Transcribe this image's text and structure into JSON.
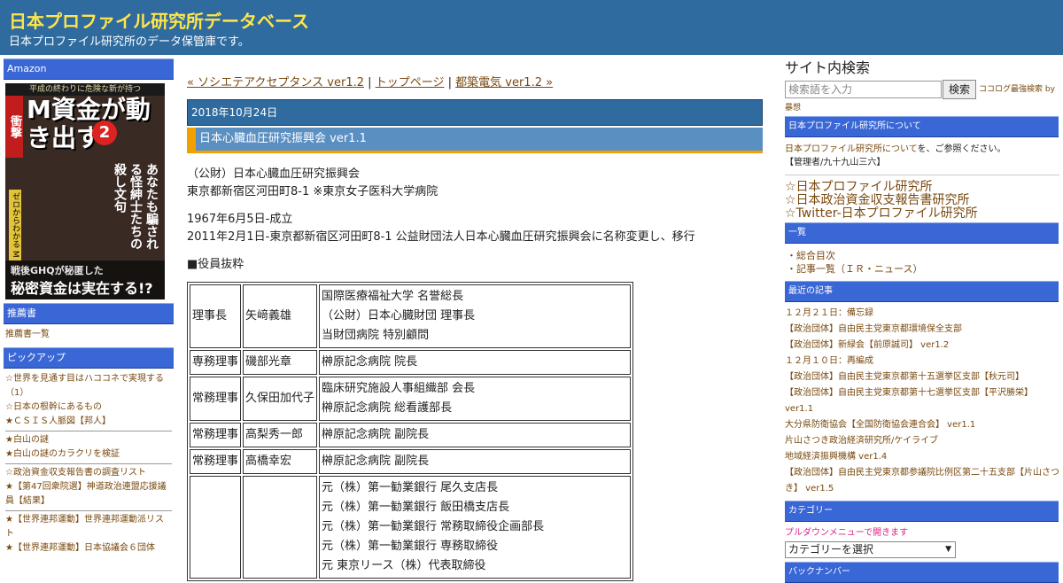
{
  "header": {
    "title": "日本プロファイル研究所データベース",
    "description": "日本プロファイル研究所のデータ保管庫です。"
  },
  "left": {
    "amazon_title": "Amazon",
    "ad": {
      "top_text": "平成の終わりに危険な新が持つ",
      "red_label": "衝撃",
      "title": "M資金が動き出す",
      "number": "2",
      "side_text": "あなたも騙される怪紳士たちの殺し文句",
      "yellow_text": "ゼロからわかる M資金読本",
      "band_line1": "戦後GHQが秘匿した",
      "band_line2": "秘密資金は実在する!?"
    },
    "recommend_title": "推薦書",
    "recommend_link": "推薦書一覧",
    "pickup_title": "ピックアップ",
    "pickup_groups": [
      [
        "☆世界を見通す目はハココネで実現する（1）",
        "☆日本の根幹にあるもの",
        "★ＣＳＩＳ人脈図【邦人】"
      ],
      [
        "★白山の謎",
        "★白山の謎のカラクリを検証"
      ],
      [
        "☆政治資金収支報告書の調査リスト",
        "★【第47回衆院選】神道政治連盟応援議員【結果】"
      ],
      [
        "★【世界連邦運動】世界連邦運動派リスト",
        "★【世界連邦運動】日本協議会６団体"
      ]
    ]
  },
  "main": {
    "nav": {
      "prev": "« ソシエテアクセプタンス ver1.2",
      "sep": "|",
      "top": "トップページ",
      "next": "都築電気 ver1.2 »"
    },
    "date": "2018年10月24日",
    "post_title": "日本心臓血圧研究振興会 ver1.1",
    "lines": [
      "（公財）日本心臓血圧研究振興会",
      "東京都新宿区河田町8-1 ※東京女子医科大学病院",
      "1967年6月5日-成立",
      "2011年2月1日-東京都新宿区河田町8-1 公益財団法人日本心臓血圧研究振興会に名称変更し、移行",
      "■役員抜粋"
    ],
    "officers": [
      {
        "role": "理事長",
        "name": "矢﨑義雄",
        "titles": [
          "国際医療福祉大学 名誉総長",
          "（公財）日本心臓財団 理事長",
          "当財団病院 特別顧問"
        ]
      },
      {
        "role": "専務理事",
        "name": "磯部光章",
        "titles": [
          "榊原記念病院 院長"
        ]
      },
      {
        "role": "常務理事",
        "name": "久保田加代子",
        "titles": [
          "臨床研究施設人事組織部 会長",
          "榊原記念病院 総看護部長"
        ]
      },
      {
        "role": "常務理事",
        "name": "高梨秀一郎",
        "titles": [
          "榊原記念病院 副院長"
        ]
      },
      {
        "role": "常務理事",
        "name": "高橋幸宏",
        "titles": [
          "榊原記念病院 副院長"
        ]
      },
      {
        "role": "",
        "name": "",
        "titles": [
          "元（株）第一勧業銀行 尾久支店長",
          "元（株）第一勧業銀行 飯田橋支店長",
          "元（株）第一勧業銀行 常務取締役企画部長",
          "元（株）第一勧業銀行 専務取締役",
          "元 東京リース（株）代表取締役"
        ]
      }
    ]
  },
  "right": {
    "search_title": "サイト内検索",
    "search_placeholder": "検索語を入力",
    "search_button": "検索",
    "search_credit": "ココログ最強検索 by",
    "search_credit2": "暴想",
    "about_title": "日本プロファイル研究所について",
    "about_link": "日本プロファイル研究所について",
    "about_suffix": "を、ご参照ください。",
    "admin": "【管理者/九十九山三六】",
    "links": [
      "☆日本プロファイル研究所",
      "☆日本政治資金収支報告書研究所",
      "☆Twitter-日本プロファイル研究所"
    ],
    "list_title": "一覧",
    "list_items": [
      "・総合目次",
      "・記事一覧（ＩＲ・ニュース）"
    ],
    "recent_title": "最近の記事",
    "recent_items": [
      "１２月２１日：備忘録",
      "【政治団体】自由民主党東京都環境保全支部",
      "【政治団体】新緑会【前原誠司】 ver1.2",
      "１２月１０日：再編成",
      "【政治団体】自由民主党東京都第十五選挙区支部【秋元司】",
      "【政治団体】自由民主党東京都第十七選挙区支部【平沢勝栄】 ver1.1",
      "大分県防衛協会【全国防衛協会連合会】 ver1.1",
      "片山さつき政治経済研究所/ケイライブ",
      "地域経済振興機構 ver1.4",
      "【政治団体】自由民主党東京都参議院比例区第二十五支部【片山さつき】 ver1.5"
    ],
    "category_title": "カテゴリー",
    "category_hint": "プルダウンメニューで開きます",
    "category_select": "カテゴリーを選択",
    "backnumber_title": "バックナンバー"
  }
}
